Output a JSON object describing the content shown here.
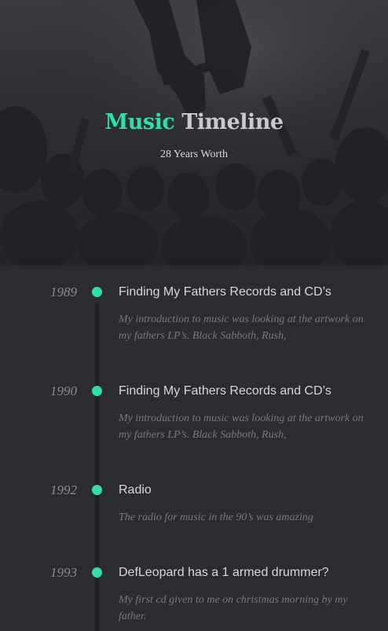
{
  "hero": {
    "title_accent": "Music",
    "title_rest": "Timeline",
    "subtitle": "28 Years Worth"
  },
  "colors": {
    "accent": "#2de0a5",
    "background": "#2b2c31",
    "line": "#1f2024"
  },
  "entries": [
    {
      "year": "1989",
      "title": "Finding My Fathers Records and CD’s",
      "description": "My introduction to music was looking at the artwork on my fathers LP’s. Black Sabboth, Rush,"
    },
    {
      "year": "1990",
      "title": "Finding My Fathers Records and CD’s",
      "description": "My introduction to music was looking at the artwork on my fathers LP’s. Black Sabboth, Rush,"
    },
    {
      "year": "1992",
      "title": "Radio",
      "description": "The radio for music in the 90’s was amazing"
    },
    {
      "year": "1993",
      "title": "DefLeopard has a 1 armed drummer?",
      "description": "My first cd given to me on christmas morning by my father."
    }
  ]
}
